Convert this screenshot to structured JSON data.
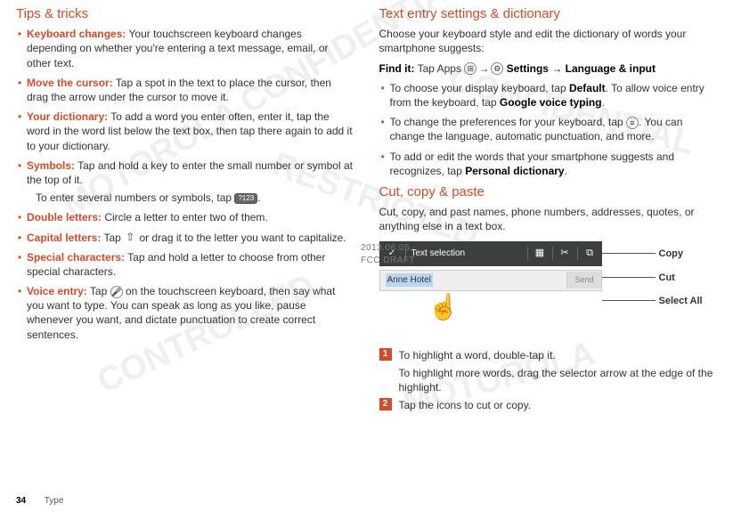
{
  "left": {
    "heading": "Tips & tricks",
    "items": [
      {
        "term": "Keyboard changes:",
        "text": " Your touchscreen keyboard changes depending on whether you're entering a text message, email, or other text."
      },
      {
        "term": "Move the cursor:",
        "text": " Tap a spot in the text to place the cursor, then drag the arrow under the cursor to move it."
      },
      {
        "term": "Your dictionary:",
        "text": " To add a word you enter often, enter it, tap the word in the word list below the text box, then tap there again to add it to your dictionary."
      },
      {
        "term": "Symbols:",
        "text": " Tap and hold a key to enter the small number or symbol at the top of it.",
        "sub_pre": "To enter several numbers or symbols, tap ",
        "sub_post": "."
      },
      {
        "term": "Double letters:",
        "text": " Circle a letter to enter two of them."
      },
      {
        "term": "Capital letters:",
        "text_pre": " Tap ",
        "text_post": " or drag it to the letter you want to capitalize."
      },
      {
        "term": "Special characters:",
        "text": " Tap and hold a letter to choose from other special characters."
      },
      {
        "term": "Voice entry:",
        "text_pre": " Tap ",
        "text_post": " on the touchscreen keyboard, then say what you want to type. You can speak as long as you like, pause whenever you want, and dictate punctuation to create correct sentences."
      }
    ],
    "kbd_label": "?123"
  },
  "right": {
    "heading1": "Text entry settings & dictionary",
    "intro1": "Choose your keyboard style and edit the dictionary of words your smartphone suggests:",
    "findit_label": "Find it:",
    "findit_pre": " Tap Apps ",
    "findit_mid": " → ",
    "findit_settings": " Settings",
    "findit_post": " → Language & input",
    "items1": [
      {
        "pre": "To choose your display keyboard, tap ",
        "b1": "Default",
        "mid": ". To allow voice entry from the keyboard, tap ",
        "b2": "Google voice typing",
        "post": "."
      },
      {
        "pre": "To change the preferences for your keyboard, tap ",
        "post": ". You can change the language, automatic punctuation, and more.",
        "icon": true
      },
      {
        "pre": "To add or edit the words that your smartphone suggests and recognizes, tap ",
        "b1": "Personal dictionary",
        "post": "."
      }
    ],
    "heading2": "Cut, copy & paste",
    "intro2": "Cut, copy, and past names, phone numbers, addresses, quotes, or anything else in a text box.",
    "bar_title": "Text selection",
    "input_text": "Anne Hotel",
    "send": "Send",
    "callouts": {
      "copy": "Copy",
      "cut": "Cut",
      "selectall": "Select All"
    },
    "steps": [
      {
        "num": "1",
        "line1": "To highlight a word, double-tap it.",
        "line2": "To highlight more words, drag the selector arrow at the edge of the highlight."
      },
      {
        "num": "2",
        "line1": "Tap the icons to cut or copy."
      }
    ]
  },
  "footer": {
    "page": "34",
    "section": "Type"
  },
  "draft": {
    "date": "2013.06.05",
    "label": "FCC DRAFT"
  }
}
